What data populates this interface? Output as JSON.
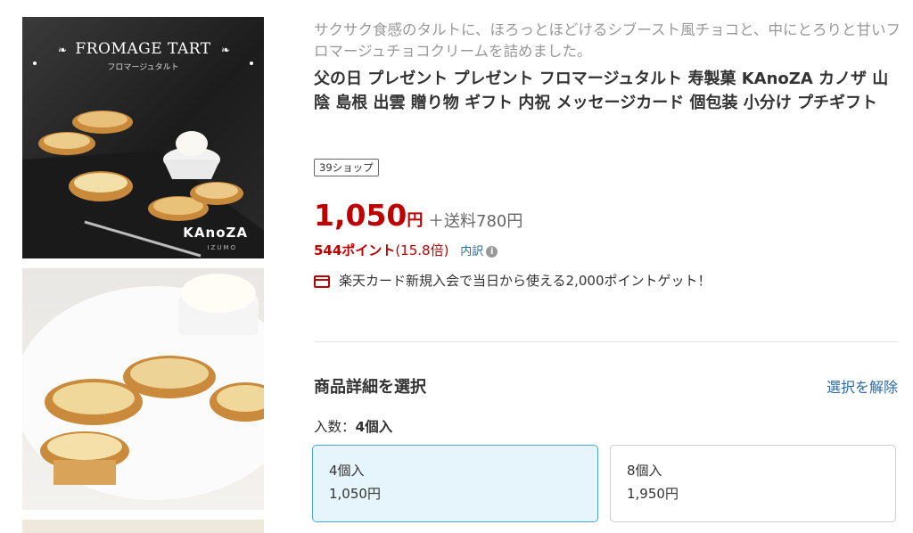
{
  "thumbnails": {
    "first": {
      "brand_title": "FROMAGE TART",
      "brand_subtitle": "フロマージュタルト",
      "logo": "KAnoZA",
      "logo_sub": "IZUMO"
    }
  },
  "product": {
    "tagline": "サクサク食感のタルトに、ほろっとほどけるシブースト風チョコと、中にとろりと甘いフロマージュチョコクリームを詰めました。",
    "title": "父の日 プレゼント プレゼント フロマージュタルト 寿製菓 KAnoZA カノザ 山陰 島根 出雲 贈り物 ギフト 内祝 メッセージカード 個包装 小分け プチギフト",
    "shop_badge": "39ショップ",
    "price_value": "1,050",
    "price_unit": "円",
    "shipping": "＋送料780円",
    "points": "544ポイント",
    "points_rate": "(15.8倍)",
    "breakdown_label": "内訳",
    "card_promo": "楽天カード新規入会で当日から使える2,000ポイントゲット！"
  },
  "options": {
    "section_title": "商品詳細を選択",
    "clear_label": "選択を解除",
    "qty_label": "入数：",
    "qty_selected": "4個入",
    "items": [
      {
        "name": "4個入",
        "price": "1,050円",
        "selected": true
      },
      {
        "name": "8個入",
        "price": "1,950円",
        "selected": false
      }
    ]
  },
  "colors": {
    "price_red": "#bf0000",
    "link_blue": "#2a6aa8",
    "selected_bg": "#e6f4fb",
    "selected_border": "#4aa7d6"
  },
  "icons": [
    "leaf-icon",
    "info-icon",
    "credit-card-icon"
  ]
}
